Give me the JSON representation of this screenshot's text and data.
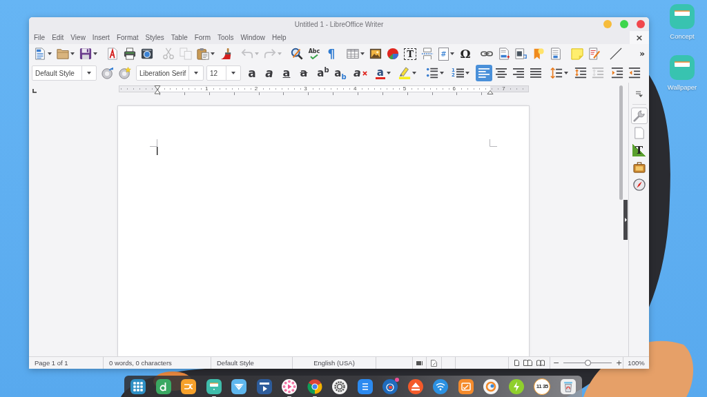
{
  "window": {
    "title": "Untitled 1 - LibreOffice Writer",
    "controls": [
      {
        "color": "#f6bc3c"
      },
      {
        "color": "#3dd64c"
      },
      {
        "color": "#f1474c"
      }
    ]
  },
  "menu_bar": {
    "items": [
      "File",
      "Edit",
      "View",
      "Insert",
      "Format",
      "Styles",
      "Table",
      "Form",
      "Tools",
      "Window",
      "Help"
    ],
    "close_document": "×"
  },
  "standard_toolbar": {
    "groups": [
      [
        {
          "kind": "new",
          "dropdown": true,
          "disabled": false
        },
        {
          "kind": "open",
          "dropdown": true,
          "disabled": false
        },
        {
          "kind": "save",
          "dropdown": true,
          "disabled": false
        }
      ],
      [
        {
          "kind": "pdf",
          "disabled": false
        },
        {
          "kind": "print",
          "disabled": false
        },
        {
          "kind": "preview",
          "disabled": false
        }
      ],
      [
        {
          "kind": "cut",
          "disabled": true
        },
        {
          "kind": "copy",
          "disabled": true
        },
        {
          "kind": "paste",
          "dropdown": true,
          "disabled": false
        },
        {
          "kind": "clone",
          "disabled": false
        }
      ],
      [
        {
          "kind": "undo",
          "dropdown": true,
          "disabled": true
        },
        {
          "kind": "redo",
          "dropdown": true,
          "disabled": true
        }
      ],
      [
        {
          "kind": "find",
          "disabled": false
        },
        {
          "kind": "spelling",
          "glyph": "Abc",
          "disabled": false
        },
        {
          "kind": "marks",
          "glyph": "¶",
          "disabled": false
        }
      ],
      [
        {
          "kind": "table",
          "dropdown": true,
          "disabled": false
        },
        {
          "kind": "image",
          "disabled": false
        },
        {
          "kind": "chart",
          "disabled": false
        },
        {
          "kind": "textbox",
          "glyph": "T",
          "disabled": false
        },
        {
          "kind": "page_break",
          "disabled": false
        },
        {
          "kind": "field",
          "glyph": "#",
          "dropdown": true,
          "disabled": false
        },
        {
          "kind": "special_character",
          "glyph": "Ω",
          "disabled": false
        }
      ],
      [
        {
          "kind": "hyperlink",
          "disabled": false
        },
        {
          "kind": "footnote",
          "disabled": false
        },
        {
          "kind": "endnote",
          "disabled": false
        },
        {
          "kind": "bookmark",
          "disabled": false
        },
        {
          "kind": "cross_reference",
          "disabled": false
        }
      ],
      [
        {
          "kind": "comment",
          "disabled": false
        },
        {
          "kind": "track_changes",
          "disabled": false
        }
      ],
      [
        {
          "kind": "line",
          "disabled": false
        }
      ]
    ],
    "overflow": "»"
  },
  "formatting_toolbar": {
    "paragraph_style": "Default Style",
    "style_buttons": [
      {
        "kind": "update_style"
      },
      {
        "kind": "new_style"
      }
    ],
    "font_name": "Liberation Serif",
    "font_size": "12",
    "groups": [
      [
        {
          "kind": "bold",
          "glyph": "a",
          "selected": false,
          "disabled": false
        },
        {
          "kind": "italic",
          "glyph": "a",
          "selected": false,
          "disabled": false
        },
        {
          "kind": "underline",
          "glyph": "a",
          "selected": false,
          "disabled": false
        },
        {
          "kind": "strikethrough",
          "glyph": "a",
          "selected": false,
          "disabled": false
        }
      ],
      [
        {
          "kind": "superscript",
          "glyph": "a$^{b}$",
          "selected": false,
          "disabled": false
        },
        {
          "kind": "subscript",
          "glyph": "a$_{b}$",
          "selected": false,
          "disabled": false
        }
      ],
      [
        {
          "kind": "clear_formatting",
          "glyph": "a",
          "selected": false,
          "disabled": false
        }
      ],
      [
        {
          "kind": "font_color",
          "glyph": "a",
          "dropdown": true,
          "selected": false,
          "disabled": false
        },
        {
          "kind": "highlight",
          "dropdown": true,
          "selected": false,
          "disabled": false
        }
      ],
      [
        {
          "kind": "bullets",
          "dropdown": true,
          "selected": false,
          "disabled": false
        },
        {
          "kind": "numbering",
          "glyph": "1 2",
          "dropdown": true,
          "selected": false,
          "disabled": false
        }
      ],
      [
        {
          "kind": "align_left",
          "selected": true,
          "disabled": false
        },
        {
          "kind": "align_center",
          "selected": false,
          "disabled": false
        },
        {
          "kind": "align_right",
          "selected": false,
          "disabled": false
        },
        {
          "kind": "justify",
          "selected": false,
          "disabled": false
        }
      ],
      [
        {
          "kind": "line_spacing",
          "dropdown": true,
          "selected": false,
          "disabled": false
        },
        {
          "kind": "spacing_increase",
          "selected": false,
          "disabled": false
        },
        {
          "kind": "spacing_decrease",
          "selected": false,
          "disabled": true
        }
      ],
      [
        {
          "kind": "indent_increase",
          "selected": false,
          "disabled": false
        },
        {
          "kind": "indent_decrease",
          "selected": false,
          "disabled": false
        }
      ]
    ]
  },
  "ruler": {
    "numbers": [
      "1",
      "2",
      "3",
      "4",
      "5",
      "6",
      "7"
    ]
  },
  "sidebar": {
    "tabs": [
      {
        "kind": "properties",
        "selected": true
      },
      {
        "kind": "page",
        "selected": false
      },
      {
        "kind": "styles",
        "glyph": "T",
        "selected": false
      },
      {
        "kind": "gallery",
        "selected": false
      },
      {
        "kind": "navigator",
        "selected": false
      }
    ]
  },
  "status_bar": {
    "page": "Page 1 of 1",
    "word_count": "0 words, 0 characters",
    "page_style": "Default Style",
    "language": "English (USA)",
    "zoom": {
      "out": "−",
      "level": 0.5,
      "in": "+",
      "percent": "100%"
    }
  },
  "desktop": {
    "icons": [
      {
        "label": "Concept"
      },
      {
        "label": "Wallpaper"
      }
    ]
  },
  "dock": {
    "apps": [
      {
        "kind": "launcher",
        "running": false,
        "notification": false
      },
      {
        "kind": "store",
        "running": false,
        "notification": false
      },
      {
        "kind": "swirl",
        "running": false,
        "notification": false
      },
      {
        "kind": "notes",
        "running": true,
        "notification": false
      },
      {
        "kind": "mail",
        "running": false,
        "notification": false
      },
      {
        "kind": "video",
        "running": false,
        "notification": false
      },
      {
        "kind": "music",
        "running": true,
        "notification": false
      },
      {
        "kind": "browser",
        "running": true,
        "notification": false
      },
      {
        "kind": "settings",
        "running": false,
        "notification": false
      },
      {
        "kind": "documents",
        "running": false,
        "notification": false
      },
      {
        "kind": "recorder",
        "running": false,
        "notification": true
      },
      {
        "kind": "eject",
        "running": false,
        "notification": false
      },
      {
        "kind": "wifi",
        "running": false,
        "notification": false
      },
      {
        "kind": "monitor",
        "running": false,
        "notification": false
      },
      {
        "kind": "ring",
        "running": false,
        "notification": false
      },
      {
        "kind": "power",
        "running": false,
        "notification": false
      },
      {
        "kind": "clock",
        "label": "11 35",
        "running": false,
        "notification": false
      },
      {
        "kind": "trash",
        "running": false,
        "notification": false
      }
    ]
  }
}
